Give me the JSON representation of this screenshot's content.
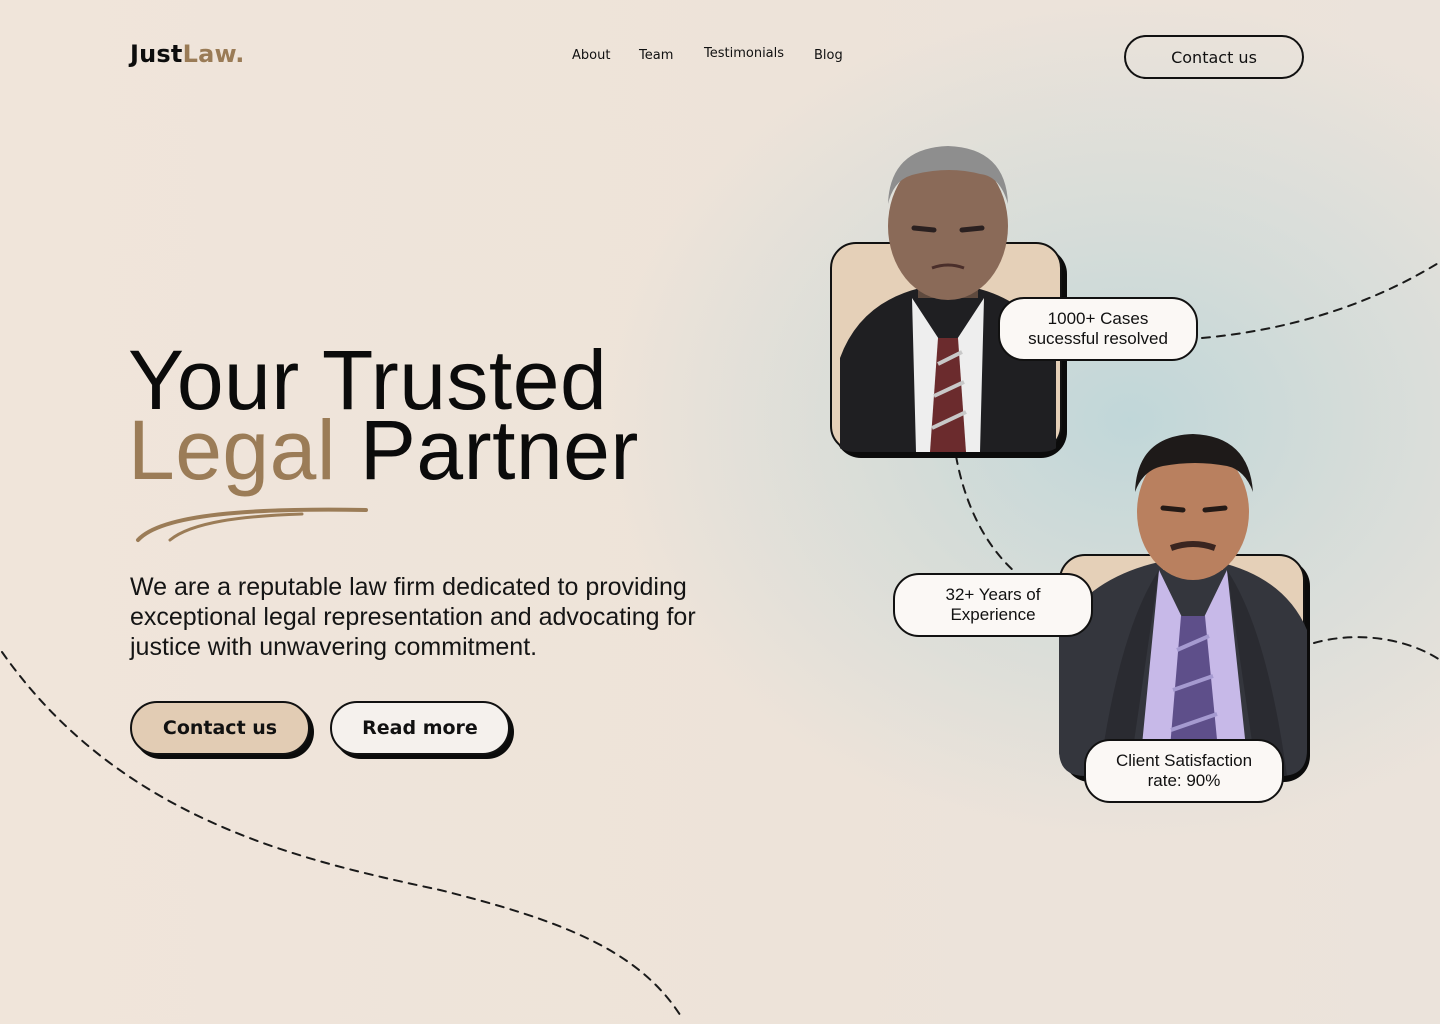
{
  "brand": {
    "name_main": "Just",
    "name_accent": "Law."
  },
  "nav": {
    "items": [
      {
        "label": "About"
      },
      {
        "label": "Team"
      },
      {
        "label": "Testimonials"
      },
      {
        "label": "Blog"
      }
    ],
    "cta_label": "Contact us"
  },
  "hero": {
    "title_line1": "Your Trusted",
    "title_accent": "Legal",
    "title_rest": " Partner",
    "description": "We are a reputable law firm dedicated to providing\nexceptional legal representation and advocating  for\njustice with  unwavering commitment.",
    "primary_button": "Contact us",
    "secondary_button": "Read more"
  },
  "stats": [
    {
      "line1": "1000+ Cases",
      "line2": "sucessful resolved"
    },
    {
      "line1": "32+ Years of",
      "line2": "Experience"
    },
    {
      "line1": "Client Satisfaction",
      "line2": "rate: 90%"
    }
  ],
  "colors": {
    "accent": "#9b7c57",
    "background": "#efe4da",
    "glow": "#bed6d9",
    "card_fill": "#e5d0b8",
    "primary_button_fill": "#e2ccb4",
    "ink": "#0b0b0b"
  },
  "icons": [
    "decorative-dashed-curves",
    "underline-swoosh"
  ]
}
